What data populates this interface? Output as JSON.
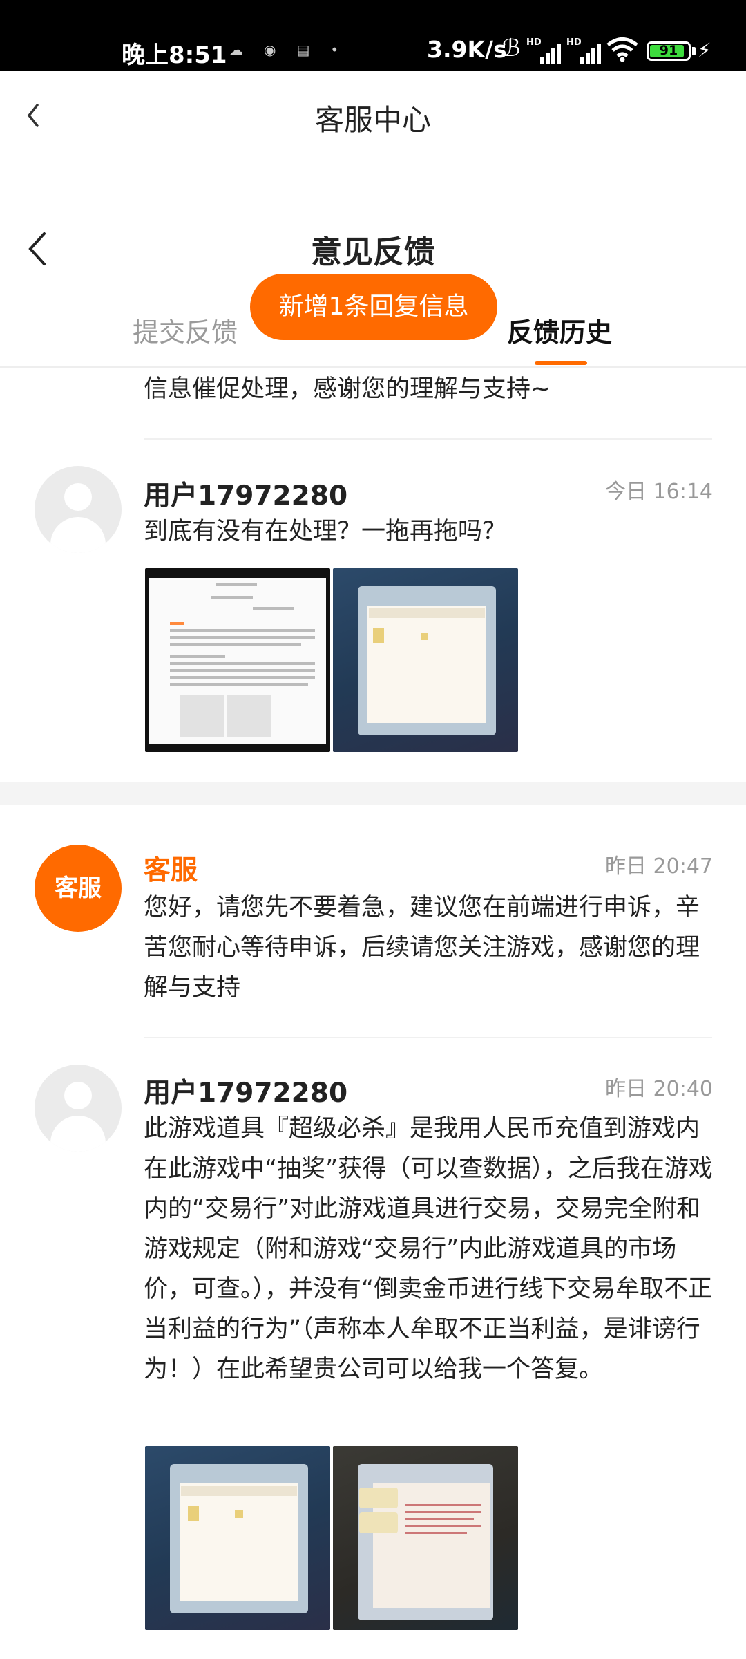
{
  "status_bar": {
    "time": "晚上8:51",
    "net_speed": "3.9K/s",
    "sim1": "HD",
    "sim2": "HD",
    "battery_level": 91,
    "battery_text": "91"
  },
  "header": {
    "title": "客服中心",
    "back_icon": "chevron-left-icon"
  },
  "feedback_page": {
    "title": "意见反馈",
    "back_icon": "chevron-left-icon",
    "tabs": [
      {
        "label": "提交反馈",
        "active": false
      },
      {
        "label": "反馈历史",
        "active": true
      }
    ],
    "toast": "新增1条回复信息",
    "accent_color": "#ff6a00"
  },
  "messages": {
    "truncated_text": "信息催促处理，感谢您的理解与支持~",
    "msg1": {
      "sender": "用户17972280",
      "time": "今日 16:14",
      "text": "到底有没有在处理？一拖再拖吗？",
      "attachments": 2
    },
    "msg2": {
      "sender": "客服",
      "avatar_label": "客服",
      "time": "昨日 20:47",
      "text": "您好，请您先不要着急，建议您在前端进行申诉，辛苦您耐心等待申诉，后续请您关注游戏，感谢您的理解与支持"
    },
    "msg3": {
      "sender": "用户17972280",
      "time": "昨日 20:40",
      "text": "此游戏道具『超级必杀』是我用人民币充值到游戏内在此游戏中“抽奖”获得（可以查数据），之后我在游戏内的“交易行”对此游戏道具进行交易，交易完全附和游戏规定（附和游戏“交易行”内此游戏道具的市场价，可查。），并没有“倒卖金币进行线下交易牟取不正当利益的行为”（声称本人牟取不正当利益，是诽谤行为！）在此希望贵公司可以给我一个答复。",
      "attachments": 2
    }
  }
}
